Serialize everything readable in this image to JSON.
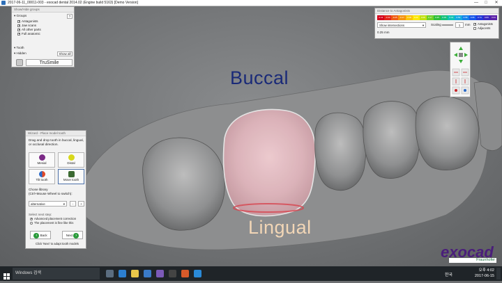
{
  "window": {
    "title": "2017-06-11_00011-003 - exocad dental 2014.02 (Engine build 5163) [Demo Version]",
    "min": "—",
    "max": "□",
    "close": "✕"
  },
  "show_hide": {
    "title": "Show/Hide groups",
    "groups_label": "Groups",
    "help": "?",
    "items": [
      "Antagonists",
      "Jaw scans",
      "All other parts",
      "Full anatomic"
    ],
    "tooth_label": "Tooth",
    "hidden_label": "Hidden",
    "show_all": "Show all",
    "trusmile": "TruSmile"
  },
  "distance": {
    "title": "Distance to Antagonists",
    "scale_values": [
      "-0.41",
      "-0.33",
      "-0.25",
      "-0.17",
      "-0.08",
      "0.00",
      "0.08",
      "0.17",
      "0.25",
      "0.33",
      "0.41",
      "0.50",
      "0.58",
      "0.66",
      "0.74",
      "0.83",
      "0.91"
    ],
    "scale_colors": [
      "#d4001a",
      "#e22218",
      "#ee5a12",
      "#f5920c",
      "#fbc308",
      "#fde804",
      "#c2e010",
      "#6fd028",
      "#2fbe3a",
      "#17c07a",
      "#10c2b4",
      "#14a8e0",
      "#1480ea",
      "#1656ea",
      "#2238d8",
      "#3a28c0",
      "#5a20a8"
    ],
    "mode": "Show intersections",
    "scaling_label": "Scaling",
    "scaling_value": "1",
    "scaling_unit": "mm",
    "value_field": "0.25 mm",
    "cb_antagonists": "Antagonists",
    "cb_adjacents": "Adjacents"
  },
  "wizard": {
    "title": "Wizard - Place model tooth",
    "instruction": "Drag and drop tooth in buccal, lingual, or occlusal direction.",
    "options": [
      {
        "label": "Mesial",
        "color": "#7b2a86"
      },
      {
        "label": "Distal",
        "color": "#d8d81c"
      },
      {
        "label": "Tilt tooth",
        "color": "#e04a2a"
      },
      {
        "label": "Move tooth",
        "color": "#3c6a32"
      }
    ],
    "library_text": "Chose library\n(Ctrl+Mouse Wheel to switch):",
    "library_value": "alternative",
    "next_step_label": "Select next step:",
    "radio1": "Advanced placement correction",
    "radio2": "The placement is fine like this",
    "back": "Back",
    "next": "Next",
    "hint": "Click 'Next' to adapt tooth models",
    "minus": "-",
    "plus": "+"
  },
  "labels": {
    "buccal": "Buccal",
    "lingual": "Lingual"
  },
  "brand": {
    "name": "exocad",
    "sub": "Fraunhofer"
  },
  "taskbar": {
    "search": "Windows 검색",
    "lang": "한국",
    "time": "오후 4:02",
    "date": "2017-06-15"
  }
}
